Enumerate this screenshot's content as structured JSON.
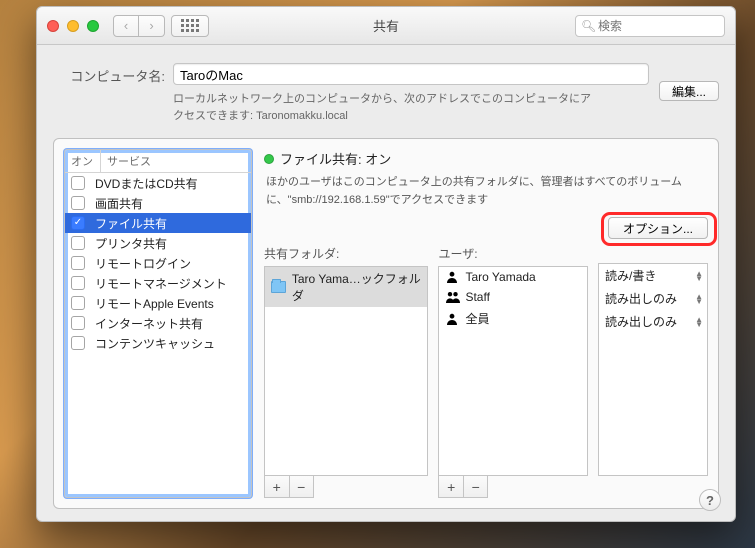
{
  "window": {
    "title": "共有",
    "search_placeholder": "検索"
  },
  "computer_name": {
    "label": "コンピュータ名:",
    "value": "TaroのMac",
    "description": "ローカルネットワーク上のコンピュータから、次のアドレスでこのコンピュータにアクセスできます: Taronomakku.local",
    "edit_button": "編集..."
  },
  "services": {
    "header_on": "オン",
    "header_service": "サービス",
    "items": [
      {
        "label": "DVDまたはCD共有",
        "checked": false
      },
      {
        "label": "画面共有",
        "checked": false
      },
      {
        "label": "ファイル共有",
        "checked": true
      },
      {
        "label": "プリンタ共有",
        "checked": false
      },
      {
        "label": "リモートログイン",
        "checked": false
      },
      {
        "label": "リモートマネージメント",
        "checked": false
      },
      {
        "label": "リモートApple Events",
        "checked": false
      },
      {
        "label": "インターネット共有",
        "checked": false
      },
      {
        "label": "コンテンツキャッシュ",
        "checked": false
      }
    ],
    "selected_index": 2
  },
  "detail": {
    "status_label": "ファイル共有: オン",
    "status_desc": "ほかのユーザはこのコンピュータ上の共有フォルダに、管理者はすべてのボリュームに、\"smb://192.168.1.59\"でアクセスできます",
    "options_button": "オプション...",
    "folders_label": "共有フォルダ:",
    "users_label": "ユーザ:",
    "folders": [
      {
        "name": "Taro Yama…ックフォルダ"
      }
    ],
    "users": [
      {
        "name": "Taro Yamada",
        "icon": "single"
      },
      {
        "name": "Staff",
        "icon": "multi"
      },
      {
        "name": "全員",
        "icon": "single"
      }
    ],
    "permissions": [
      "読み/書き",
      "読み出しのみ",
      "読み出しのみ"
    ]
  }
}
